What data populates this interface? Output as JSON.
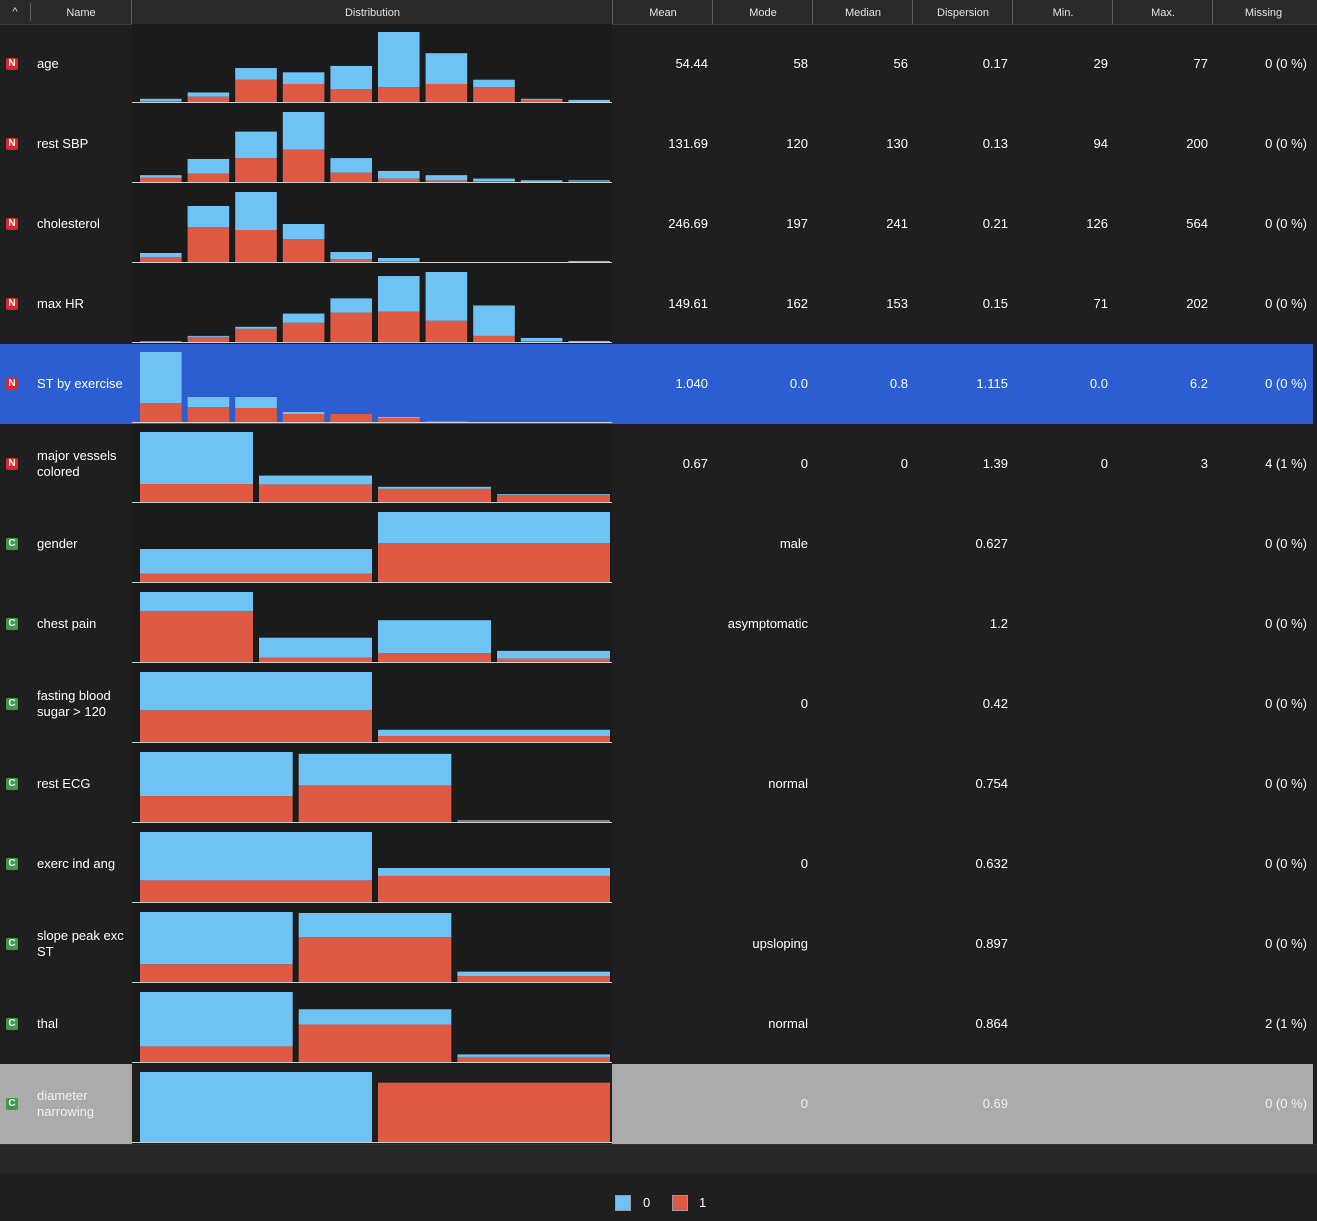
{
  "header": {
    "sort_icon": "^",
    "name": "Name",
    "distribution": "Distribution",
    "mean": "Mean",
    "mode": "Mode",
    "median": "Median",
    "dispersion": "Dispersion",
    "min": "Min.",
    "max": "Max.",
    "missing": "Missing"
  },
  "colors": {
    "class0": "#6fc3f4",
    "class1": "#e05a43",
    "selected": "#2c5dd1"
  },
  "legend": {
    "items": [
      {
        "label": "0",
        "color": "#6fc3f4"
      },
      {
        "label": "1",
        "color": "#e05a43"
      }
    ]
  },
  "rows": [
    {
      "type": "N",
      "name": "age",
      "mean": "54.44",
      "mode": "58",
      "median": "56",
      "dispersion": "0.17",
      "min": "29",
      "max": "77",
      "missing": "0 (0 %)",
      "bins": [
        [
          2,
          1
        ],
        [
          4,
          5
        ],
        [
          11,
          21
        ],
        [
          11,
          17
        ],
        [
          22,
          12
        ],
        [
          52,
          14
        ],
        [
          29,
          17
        ],
        [
          7,
          14
        ],
        [
          1,
          2
        ],
        [
          2,
          0
        ]
      ]
    },
    {
      "type": "N",
      "name": "rest SBP",
      "mean": "131.69",
      "mode": "120",
      "median": "130",
      "dispersion": "0.13",
      "min": "94",
      "max": "200",
      "missing": "0 (0 %)",
      "bins": [
        [
          3,
          5
        ],
        [
          17,
          10
        ],
        [
          31,
          28
        ],
        [
          44,
          38
        ],
        [
          17,
          11
        ],
        [
          9,
          4
        ],
        [
          6,
          2
        ],
        [
          3,
          1
        ],
        [
          2,
          0
        ],
        [
          1,
          1
        ]
      ]
    },
    {
      "type": "N",
      "name": "cholesterol",
      "mean": "246.69",
      "mode": "197",
      "median": "241",
      "dispersion": "0.21",
      "min": "126",
      "max": "564",
      "missing": "0 (0 %)",
      "bins": [
        [
          4,
          5
        ],
        [
          21,
          35
        ],
        [
          38,
          32
        ],
        [
          15,
          23
        ],
        [
          7,
          3
        ],
        [
          3,
          1
        ],
        [
          0,
          0
        ],
        [
          0,
          0
        ],
        [
          0,
          0
        ],
        [
          1,
          0
        ]
      ]
    },
    {
      "type": "N",
      "name": "max HR",
      "mean": "149.61",
      "mode": "162",
      "median": "153",
      "dispersion": "0.15",
      "min": "71",
      "max": "202",
      "missing": "0 (0 %)",
      "bins": [
        [
          0,
          1
        ],
        [
          1,
          5
        ],
        [
          2,
          13
        ],
        [
          9,
          19
        ],
        [
          14,
          29
        ],
        [
          35,
          30
        ],
        [
          48,
          21
        ],
        [
          30,
          6
        ],
        [
          3,
          1
        ],
        [
          1,
          0
        ]
      ]
    },
    {
      "type": "N",
      "name": "ST by exercise",
      "mean": "1.040",
      "mode": "0.0",
      "median": "0.8",
      "dispersion": "1.115",
      "min": "0.0",
      "max": "6.2",
      "missing": "0 (0 %)",
      "selected": true,
      "bins": [
        [
          51,
          19
        ],
        [
          10,
          15
        ],
        [
          11,
          14
        ],
        [
          2,
          8
        ],
        [
          0,
          8
        ],
        [
          1,
          4
        ],
        [
          0,
          1
        ],
        [
          0,
          0
        ],
        [
          0,
          0
        ],
        [
          0,
          0
        ]
      ]
    },
    {
      "type": "N",
      "name": "major vessels colored",
      "mean": "0.67",
      "mode": "0",
      "median": "0",
      "dispersion": "1.39",
      "min": "0",
      "max": "3",
      "missing": "4 (1 %)",
      "bins": [
        [
          130,
          45
        ],
        [
          22,
          44
        ],
        [
          5,
          33
        ],
        [
          2,
          18
        ]
      ]
    },
    {
      "type": "C",
      "name": "gender",
      "mean": "",
      "mode": "male",
      "median": "",
      "dispersion": "0.627",
      "min": "",
      "max": "",
      "missing": "0 (0 %)",
      "bins": [
        [
          72,
          25
        ],
        [
          92,
          114
        ]
      ]
    },
    {
      "type": "C",
      "name": "chest pain",
      "mean": "",
      "mode": "asymptomatic",
      "median": "",
      "dispersion": "1.2",
      "min": "",
      "max": "",
      "missing": "0 (0 %)",
      "bins": [
        [
          39,
          105
        ],
        [
          41,
          9
        ],
        [
          68,
          18
        ],
        [
          16,
          7
        ]
      ]
    },
    {
      "type": "C",
      "name": "fasting blood sugar > 120",
      "mean": "",
      "mode": "0",
      "median": "",
      "dispersion": "0.42",
      "min": "",
      "max": "",
      "missing": "0 (0 %)",
      "bins": [
        [
          141,
          117
        ],
        [
          23,
          22
        ]
      ]
    },
    {
      "type": "C",
      "name": "rest ECG",
      "mean": "",
      "mode": "normal",
      "median": "",
      "dispersion": "0.754",
      "min": "",
      "max": "",
      "missing": "0 (0 %)",
      "bins": [
        [
          95,
          56
        ],
        [
          68,
          79
        ],
        [
          1,
          3
        ]
      ]
    },
    {
      "type": "C",
      "name": "exerc ind ang",
      "mean": "",
      "mode": "0",
      "median": "",
      "dispersion": "0.632",
      "min": "",
      "max": "",
      "missing": "0 (0 %)",
      "bins": [
        [
          141,
          63
        ],
        [
          23,
          76
        ]
      ]
    },
    {
      "type": "C",
      "name": "slope peak exc ST",
      "mean": "",
      "mode": "upsloping",
      "median": "",
      "dispersion": "0.897",
      "min": "",
      "max": "",
      "missing": "0 (0 %)",
      "bins": [
        [
          106,
          36
        ],
        [
          49,
          91
        ],
        [
          9,
          12
        ]
      ]
    },
    {
      "type": "C",
      "name": "thal",
      "mean": "",
      "mode": "normal",
      "median": "",
      "dispersion": "0.864",
      "min": "",
      "max": "",
      "missing": "2 (1 %)",
      "bins": [
        [
          129,
          37
        ],
        [
          36,
          89
        ],
        [
          6,
          12
        ]
      ]
    },
    {
      "type": "C",
      "name": "diameter narrowing",
      "mean": "",
      "mode": "0",
      "median": "",
      "dispersion": "0.69",
      "min": "",
      "max": "",
      "missing": "0 (0 %)",
      "highlight": true,
      "bins": [
        [
          164,
          0
        ],
        [
          0,
          139
        ]
      ]
    }
  ]
}
